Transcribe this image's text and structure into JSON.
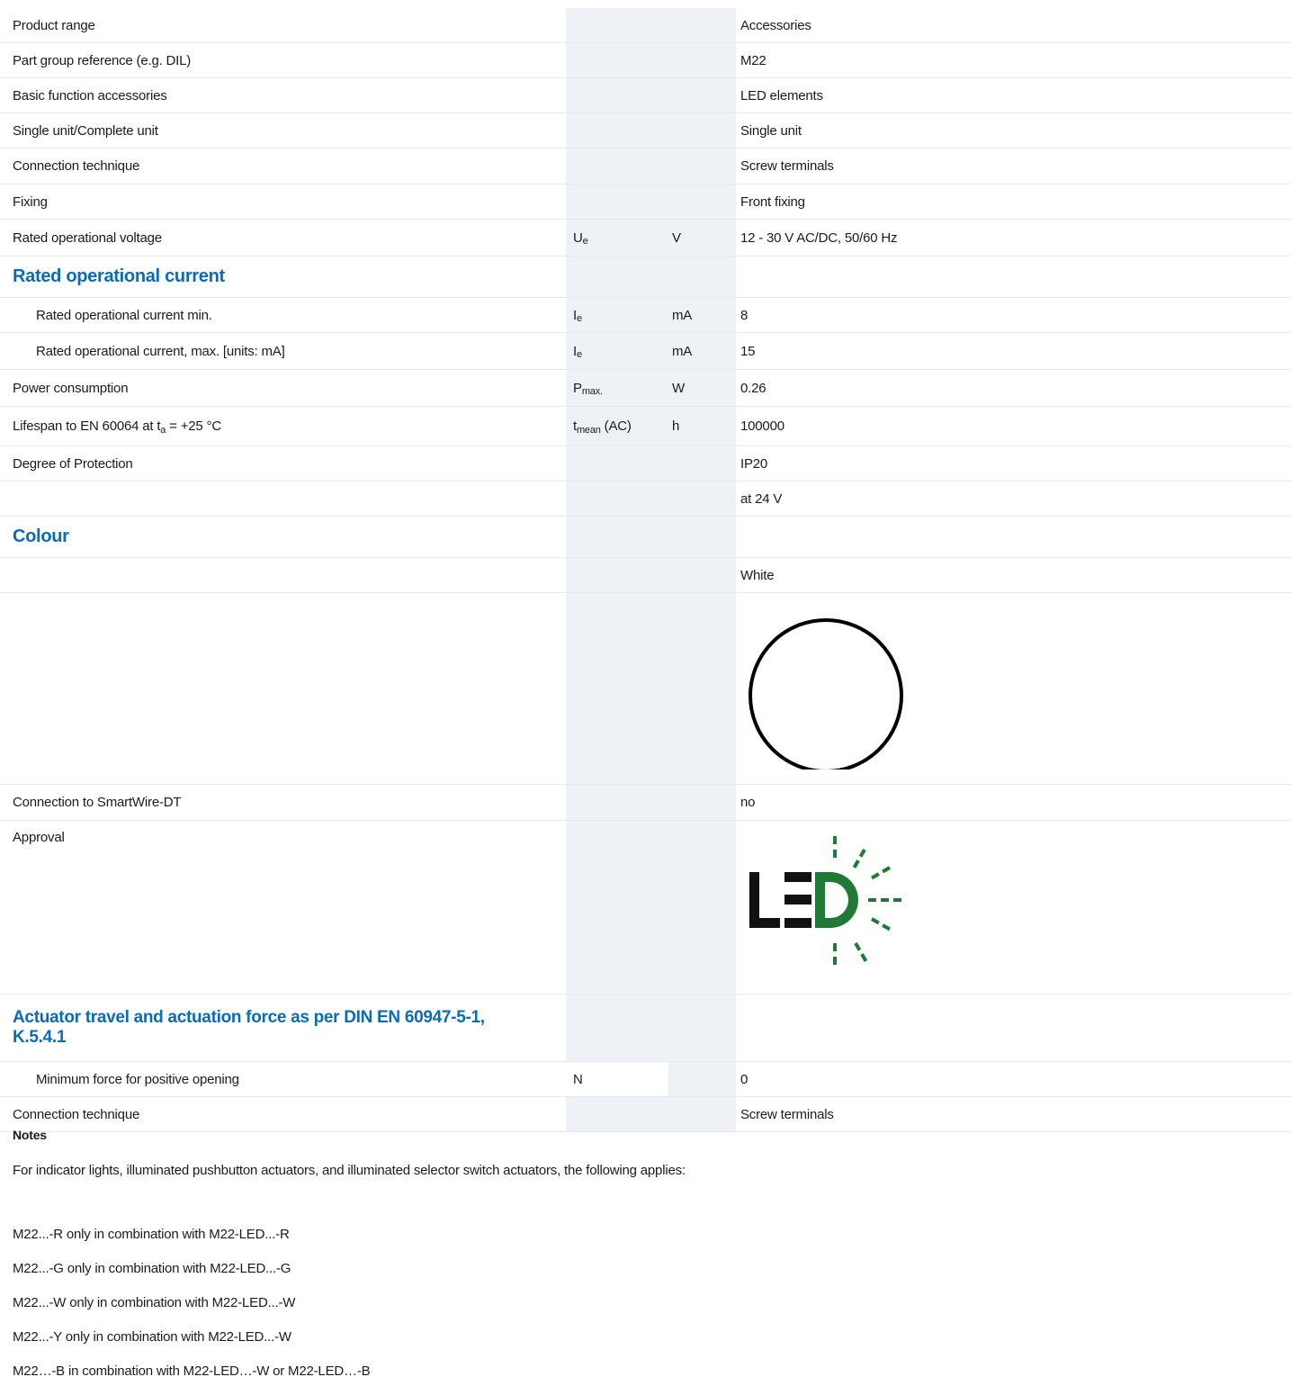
{
  "section_title": "",
  "rows": {
    "product_range": {
      "label": "Product range",
      "value": "Accessories"
    },
    "part_group": {
      "label": "Part group reference (e.g. DIL)",
      "value": "M22"
    },
    "basic_function": {
      "label": "Basic function accessories",
      "value": "LED elements"
    },
    "single_unit": {
      "label": "Single unit/Complete unit",
      "value": "Single unit"
    },
    "connection_technique": {
      "label": "Connection technique",
      "value": "Screw terminals"
    },
    "fixing": {
      "label": "Fixing",
      "value": "Front fixing"
    },
    "rated_voltage": {
      "label": "Rated operational voltage",
      "sym": "U",
      "sym_sub": "e",
      "unit": "V",
      "value": "12 - 30 V AC/DC, 50/60 Hz"
    },
    "rated_current_heading": {
      "label": "Rated operational current"
    },
    "rated_current_min": {
      "label": "Rated operational current min.",
      "sym": "I",
      "sym_sub": "e",
      "unit": "mA",
      "value": "8"
    },
    "rated_current_max": {
      "label": "Rated operational current, max. [units: mA]",
      "sym": "I",
      "sym_sub": "e",
      "unit": "mA",
      "value": "15"
    },
    "power_consumption": {
      "label": "Power consumption",
      "sym": "P",
      "sym_sub": "max.",
      "unit": "W",
      "value": "0.26"
    },
    "lifespan": {
      "label_pre": "Lifespan to EN 60064 at t",
      "label_sub": "a",
      "label_post": " = +25 °C",
      "sym": "t",
      "sym_sub": "mean",
      "sym_post": " (AC)",
      "unit": "h",
      "value": "100000"
    },
    "degree_protection": {
      "label": "Degree of Protection",
      "value": "IP20"
    },
    "at_24v": {
      "value": "at 24 V"
    },
    "colour_heading": {
      "label": "Colour"
    },
    "colour_value": {
      "value": "White"
    },
    "smartwire": {
      "label": "Connection to SmartWire-DT",
      "value": "no"
    },
    "approval": {
      "label": "Approval",
      "logo_text": "LED"
    },
    "actuator_heading": {
      "label_line1": "Actuator travel and actuation force as per DIN EN 60947-5-1,",
      "label_line2": "K.5.4.1"
    },
    "min_force": {
      "label": "Minimum force for positive opening",
      "sym": "N",
      "value": "0"
    },
    "connection_technique_2": {
      "label": "Connection technique",
      "value": "Screw terminals"
    }
  },
  "notes": {
    "title": "Notes",
    "intro": "For indicator lights, illuminated pushbutton actuators, and illuminated selector switch actuators, the following applies:",
    "lines": [
      "M22...-R only in combination with M22-LED...-R",
      "M22...-G only in combination with M22-LED...-G",
      "M22...-W only in combination with M22-LED...-W",
      "M22...-Y only in combination with M22-LED...-W",
      "M22…-B in combination with M22-LED…-W or M22-LED…-B"
    ]
  },
  "colors": {
    "heading_blue": "#0a6bb8",
    "led_green": "#1e7a34",
    "column_shade": "#eef1f5"
  },
  "icons": {
    "colour_swatch": "white-circle-icon",
    "approval_logo": "led-logo-icon"
  }
}
